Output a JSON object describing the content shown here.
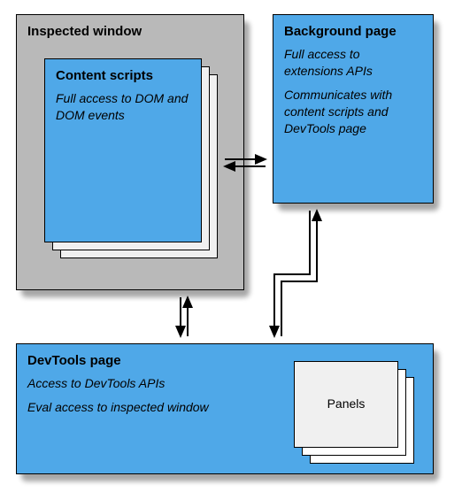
{
  "inspected": {
    "title": "Inspected window"
  },
  "contentScripts": {
    "title": "Content scripts",
    "desc": "Full access to DOM and DOM events"
  },
  "background": {
    "title": "Background page",
    "desc1": "Full access to extensions APIs",
    "desc2": "Communicates with content scripts and DevTools page"
  },
  "devtools": {
    "title": "DevTools page",
    "desc1": "Access to DevTools APIs",
    "desc2": "Eval access to inspected window"
  },
  "panels": {
    "label": "Panels"
  }
}
